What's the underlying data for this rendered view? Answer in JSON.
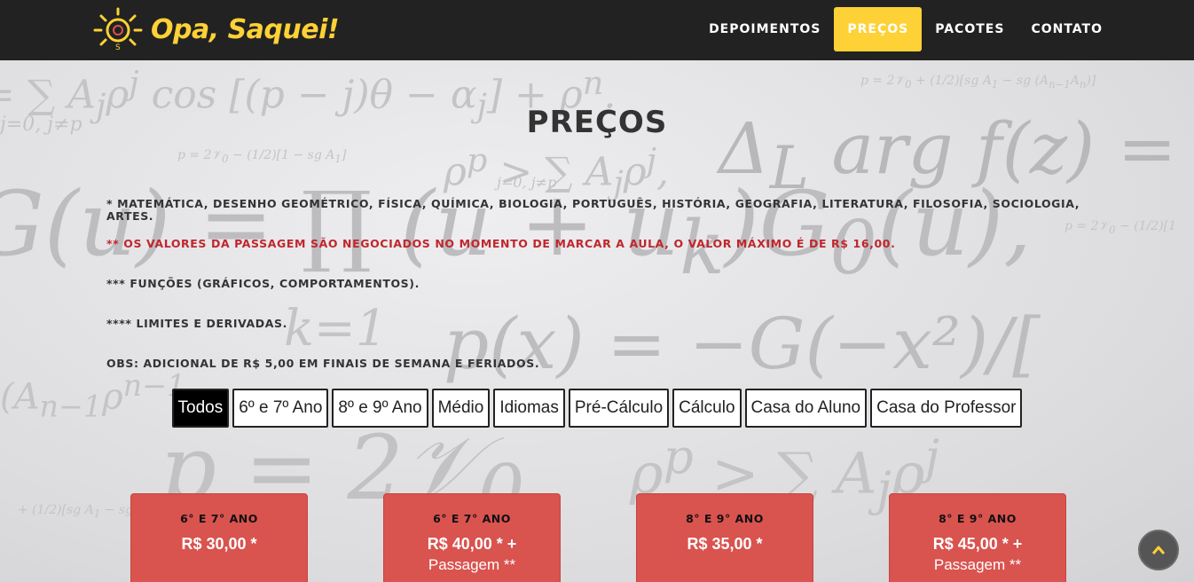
{
  "brand": {
    "name": "Opa, Saquei!",
    "color": "#fed136"
  },
  "nav": {
    "items": [
      {
        "label": "DEPOIMENTOS",
        "active": false
      },
      {
        "label": "PREÇOS",
        "active": true
      },
      {
        "label": "PACOTES",
        "active": false
      },
      {
        "label": "CONTATO",
        "active": false
      }
    ]
  },
  "section": {
    "title": "PREÇOS",
    "notes": [
      "* MATEMÁTICA, DESENHO GEOMÉTRICO, FÍSICA, QUÍMICA, BIOLOGIA, PORTUGUÊS, HISTÓRIA, GEOGRAFIA, LITERATURA, FILOSOFIA, SOCIOLOGIA, ARTES.",
      "** OS VALORES DA PASSAGEM SÃO NEGOCIADOS NO MOMENTO DE MARCAR A AULA, O VALOR MÁXIMO É DE R$ 16,00.",
      "*** FUNÇÕES (GRÁFICOS, COMPORTAMENTOS).",
      "**** LIMITES E DERIVADAS.",
      "OBS: ADICIONAL DE R$ 5,00 EM FINAIS DE SEMANA E FERIADOS."
    ],
    "note_colors": [
      "#333333",
      "#c0262c",
      "#333333",
      "#333333",
      "#333333"
    ]
  },
  "filters": [
    {
      "label": "Todos",
      "active": true
    },
    {
      "label": "6º e 7º Ano",
      "active": false
    },
    {
      "label": "8º e 9º Ano",
      "active": false
    },
    {
      "label": "Médio",
      "active": false
    },
    {
      "label": "Idiomas",
      "active": false
    },
    {
      "label": "Pré-Cálculo",
      "active": false
    },
    {
      "label": "Cálculo",
      "active": false
    },
    {
      "label": "Casa do Aluno",
      "active": false
    },
    {
      "label": "Casa do Professor",
      "active": false
    }
  ],
  "cards": [
    {
      "grade": "6° E 7° ANO",
      "price": "R$ 30,00 *",
      "extra": ""
    },
    {
      "grade": "6° E 7° ANO",
      "price": "R$ 40,00 * +",
      "extra": "Passagem **"
    },
    {
      "grade": "8° E 9° ANO",
      "price": "R$ 35,00 *",
      "extra": ""
    },
    {
      "grade": "8° E 9° ANO",
      "price": "R$ 45,00 * +",
      "extra": "Passagem **"
    }
  ],
  "colors": {
    "card": "#d9534f",
    "navbar": "#222222",
    "accent": "#fed136"
  },
  "icons": {
    "logo": "lightbulb-icon",
    "scroll_top": "chevron-up-icon"
  }
}
